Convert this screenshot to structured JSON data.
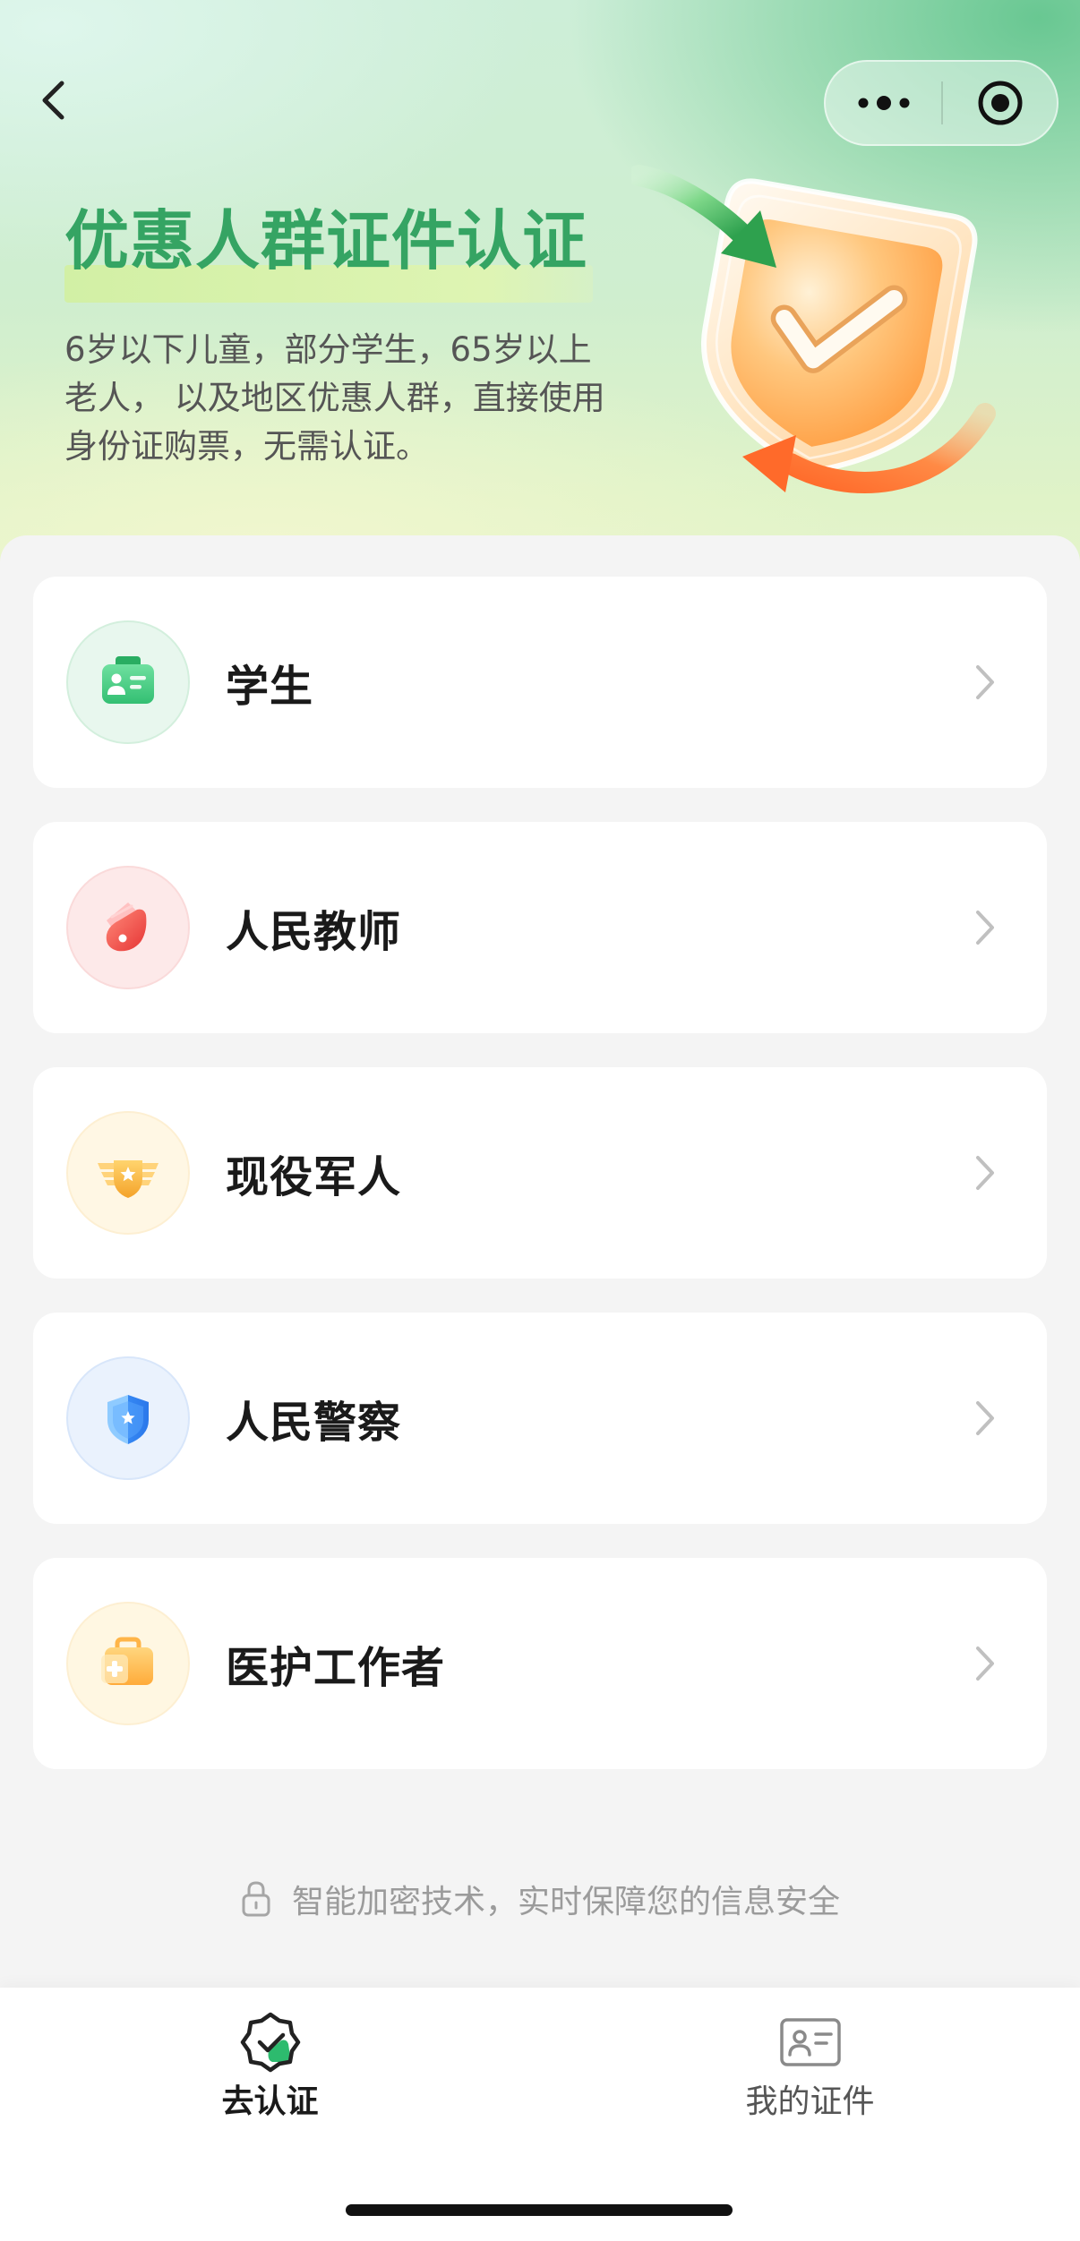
{
  "nav": {
    "back_icon": "chevron-left-icon",
    "menu_icons": [
      "more-dots-icon",
      "target-icon"
    ]
  },
  "header": {
    "title": "优惠人群证件认证",
    "subtitle_lines": [
      "6岁以下儿童，部分学生，65岁以上",
      "老人， 以及地区优惠人群，直接使用",
      "身份证购票，无需认证。"
    ],
    "illustration_icon": "shield-check-icon"
  },
  "categories": [
    {
      "label": "学生",
      "icon": "student-id-icon",
      "color": "#3cc679"
    },
    {
      "label": "人民教师",
      "icon": "teacher-icon",
      "color": "#f04848"
    },
    {
      "label": "现役军人",
      "icon": "soldier-badge-icon",
      "color": "#f7b232"
    },
    {
      "label": "人民警察",
      "icon": "police-shield-icon",
      "color": "#3d8ff5"
    },
    {
      "label": "医护工作者",
      "icon": "medical-kit-icon",
      "color": "#ffb23f"
    }
  ],
  "security_note": {
    "icon": "lock-icon",
    "text": "智能加密技术，实时保障您的信息安全"
  },
  "tabbar": {
    "tabs": [
      {
        "label": "去认证",
        "icon": "verify-badge-icon",
        "active": true
      },
      {
        "label": "我的证件",
        "icon": "id-card-icon",
        "active": false
      }
    ]
  },
  "colors": {
    "accent": "#35a463",
    "page_bg": "#f4f4f4",
    "card_bg": "#ffffff",
    "chevron": "#c0c0c0",
    "note_text": "#9b9b9b"
  }
}
